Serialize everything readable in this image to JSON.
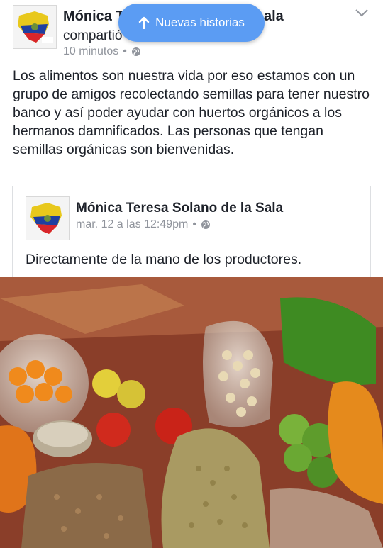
{
  "post": {
    "author_visible_start": "Mónica T",
    "author_visible_end": "ala",
    "action_visible": "compartió",
    "timestamp": "10 minutos",
    "separator": "•",
    "privacy_icon": "globe-icon",
    "text": "Los alimentos son nuestra vida por eso estamos con un grupo de amigos recolectando semillas para tener nuestro banco y así poder ayudar con huertos orgánicos a los hermanos damnificados. Las personas que tengan semillas orgánicas son bienvenidas."
  },
  "notification_pill": {
    "label": "Nuevas historias",
    "icon": "arrow-up-icon",
    "color": "#5b9cf3"
  },
  "shared_post": {
    "author": "Mónica Teresa Solano de la Sala",
    "timestamp": "mar. 12 a las 12:49pm",
    "separator": "•",
    "privacy_icon": "globe-icon",
    "text": "Directamente de la mano de los productores."
  },
  "colors": {
    "text": "#1d2129",
    "meta": "#90949c",
    "border": "#dddfe2"
  }
}
